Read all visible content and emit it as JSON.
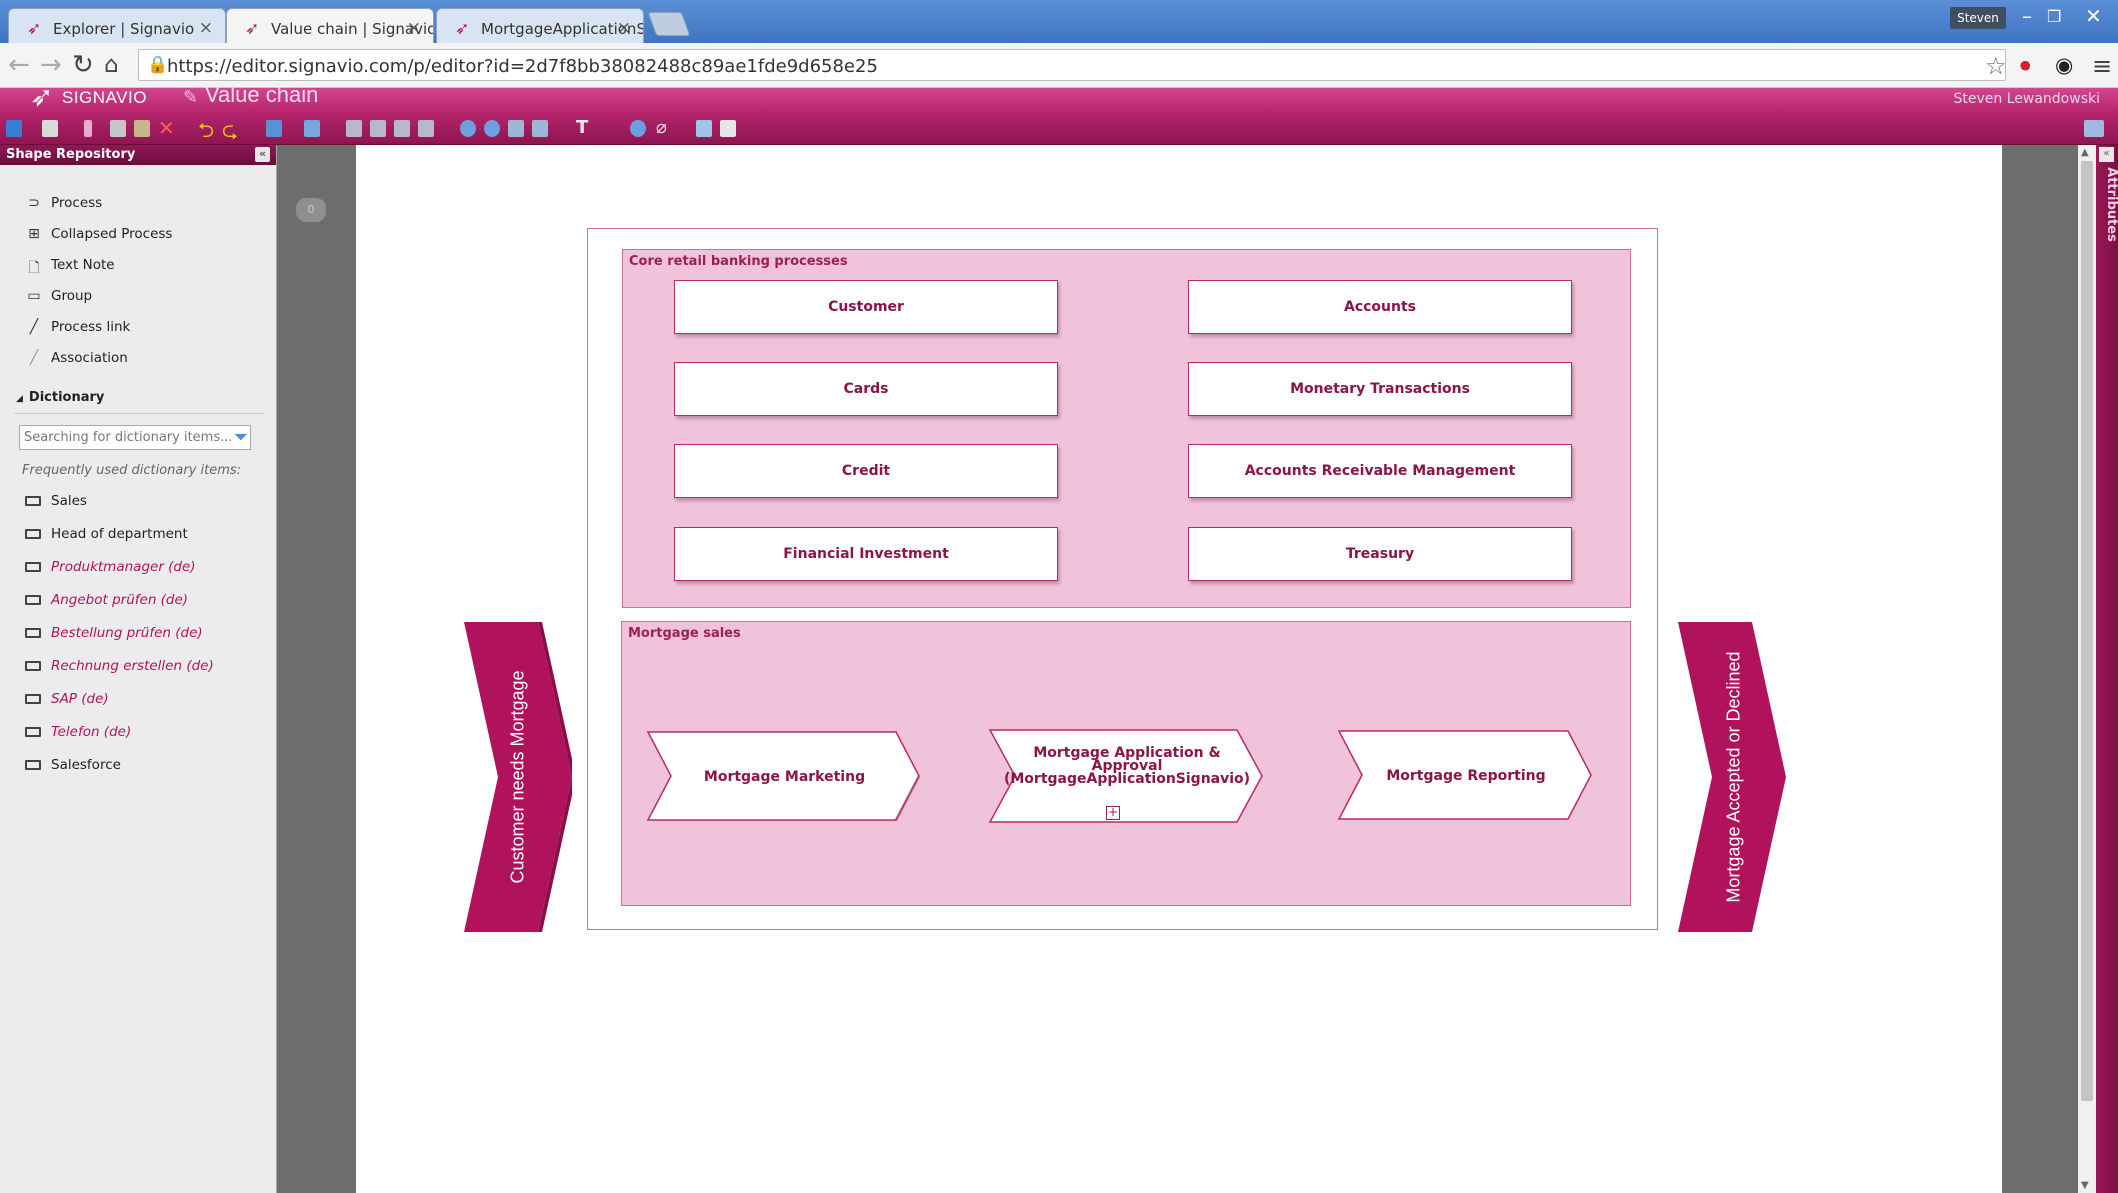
{
  "browser": {
    "tabs": [
      {
        "title": "Explorer | Signavio"
      },
      {
        "title": "Value chain | Signavio"
      },
      {
        "title": "MortgageApplicationSign"
      }
    ],
    "user_badge": "Steven",
    "url": "https://editor.signavio.com/p/editor?id=2d7f8bb38082488c89ae1fde9d658e25"
  },
  "app": {
    "logo": "SIGNAVIO",
    "document_title": "Value chain",
    "user_name": "Steven Lewandowski"
  },
  "shape_repository": {
    "title": "Shape Repository",
    "items": [
      {
        "label": "Process",
        "icon": "process-icon"
      },
      {
        "label": "Collapsed Process",
        "icon": "collapsed-process-icon"
      },
      {
        "label": "Text Note",
        "icon": "text-note-icon"
      },
      {
        "label": "Group",
        "icon": "group-icon"
      },
      {
        "label": "Process link",
        "icon": "process-link-icon"
      },
      {
        "label": "Association",
        "icon": "association-icon"
      }
    ],
    "dictionary": {
      "title": "Dictionary",
      "search_placeholder": "Searching for dictionary items...",
      "frequent_label": "Frequently used dictionary items:",
      "items": [
        {
          "label": "Sales"
        },
        {
          "label": "Head of department"
        },
        {
          "label": "Produktmanager (de)"
        },
        {
          "label": "Angebot prüfen (de)"
        },
        {
          "label": "Bestellung prüfen (de)"
        },
        {
          "label": "Rechnung erstellen (de)"
        },
        {
          "label": "SAP (de)"
        },
        {
          "label": "Telefon (de)"
        },
        {
          "label": "Salesforce"
        }
      ]
    }
  },
  "attributes_panel": {
    "label": "Attributes"
  },
  "comment_bubble": {
    "count": "0"
  },
  "diagram": {
    "start_event": "Customer needs Mortgage",
    "end_event": "Mortgage Accepted or Declined",
    "core_group": {
      "title": "Core retail banking processes",
      "processes": [
        "Customer",
        "Accounts",
        "Cards",
        "Monetary Transactions",
        "Credit",
        "Accounts Receivable Management",
        "Financial Investment",
        "Treasury"
      ]
    },
    "mortgage_group": {
      "title": "Mortgage sales",
      "processes": [
        "Mortgage Marketing",
        "Mortgage Application & Approval (MortgageApplicationSignavio)",
        "Mortgage Reporting"
      ]
    }
  },
  "colors": {
    "brand": "#b0125b",
    "group_fill": "#f0c3da",
    "group_border": "#d86aa3"
  }
}
